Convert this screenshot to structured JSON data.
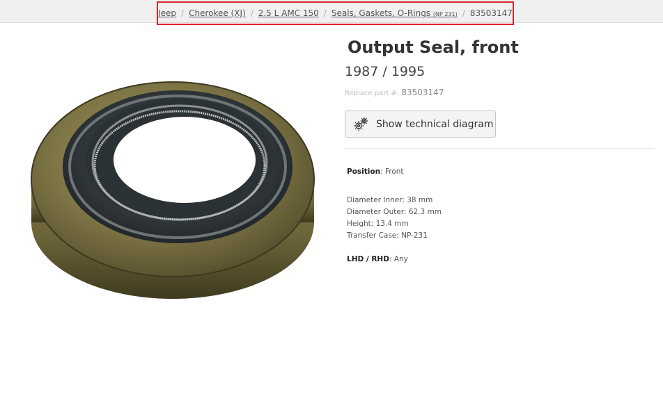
{
  "breadcrumb": {
    "items": [
      {
        "label": "Jeep"
      },
      {
        "label": "Cherokee (XJ)"
      },
      {
        "label": "2.5 L AMC 150"
      },
      {
        "label": "Seals, Gaskets, O-Rings",
        "suffix": "(NP 231)"
      }
    ],
    "separator": "/",
    "current": "83503147"
  },
  "product": {
    "title": "Output Seal, front",
    "years": "1987 / 1995",
    "replace_label": "Replace part #:",
    "replace_number": "83503147",
    "diagram_button": "Show technical diagram",
    "diagram_icon": "gears-icon"
  },
  "specs": {
    "position_label": "Position",
    "position_value": ": Front",
    "lines": [
      "Diameter Inner: 38 mm",
      "Diameter Outer: 62.3 mm",
      "Height: 13.4 mm",
      "Transfer Case: NP-231"
    ],
    "lhd_label": "LHD / RHD",
    "lhd_value": ": Any"
  },
  "colors": {
    "highlight_border": "#d9252b",
    "topbar_bg": "#f0f0f0"
  }
}
